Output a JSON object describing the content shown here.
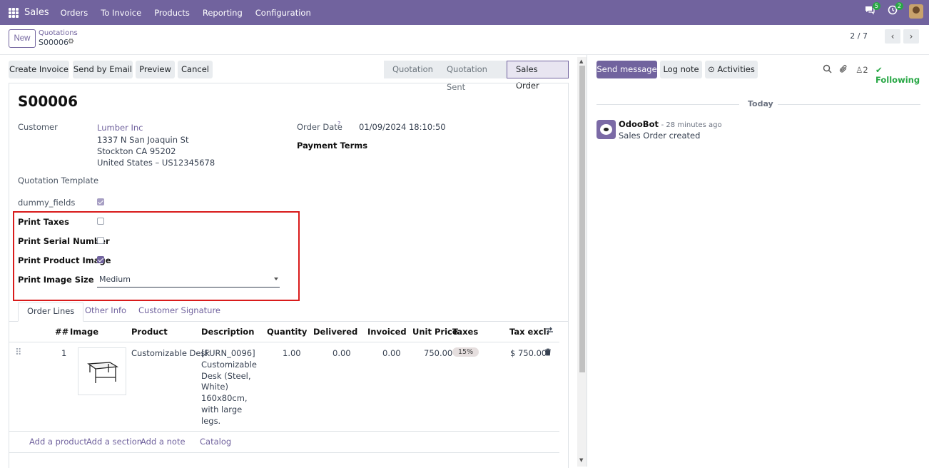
{
  "topbar": {
    "app_name": "Sales",
    "menu": [
      "Orders",
      "To Invoice",
      "Products",
      "Reporting",
      "Configuration"
    ],
    "messages_badge": "5",
    "activities_badge": "2"
  },
  "control": {
    "new_label": "New",
    "breadcrumb_parent": "Quotations",
    "breadcrumb_current": "S00006",
    "pager": "2 / 7"
  },
  "actions": {
    "create_invoice": "Create Invoice",
    "send_email": "Send by Email",
    "preview": "Preview",
    "cancel": "Cancel"
  },
  "statusbar": {
    "stages": [
      "Quotation",
      "Quotation Sent",
      "Sales Order"
    ],
    "active": "Sales Order"
  },
  "form": {
    "title": "S00006",
    "customer_label": "Customer",
    "customer_name": "Lumber Inc",
    "address_line1": "1337 N San Joaquin St",
    "address_line2": "Stockton CA 95202",
    "address_line3": "United States – US12345678",
    "order_date_label": "Order Date",
    "order_date_help": "?",
    "order_date": "01/09/2024 18:10:50",
    "payment_terms_label": "Payment Terms",
    "quotation_template_label": "Quotation Template",
    "dummy_fields_label": "dummy_fields",
    "print_taxes_label": "Print Taxes",
    "print_serial_label": "Print Serial Number",
    "print_product_image_label": "Print Product Image",
    "print_image_size_label": "Print Image Size",
    "print_image_size_value": "Medium",
    "dummy_fields_checked": true,
    "print_taxes_checked": false,
    "print_serial_checked": false,
    "print_product_image_checked": true
  },
  "tabs": [
    "Order Lines",
    "Other Info",
    "Customer Signature"
  ],
  "table": {
    "headers": [
      "##",
      "Image",
      "Product",
      "Description",
      "Quantity",
      "Delivered",
      "Invoiced",
      "Unit Price",
      "Taxes",
      "Tax excl."
    ],
    "row": {
      "seq": "1",
      "product": "Customizable Desk",
      "description": [
        "[FURN_0096]",
        "Customizable",
        "Desk (Steel,",
        "White)",
        "160x80cm,",
        "with large",
        "legs."
      ],
      "quantity": "1.00",
      "delivered": "0.00",
      "invoiced": "0.00",
      "unit_price": "750.00",
      "taxes": "15%",
      "subtotal": "$ 750.00"
    },
    "add_links": [
      "Add a product",
      "Add a section",
      "Add a note",
      "Catalog"
    ]
  },
  "chatter": {
    "send_message": "Send message",
    "log_note": "Log note",
    "activities": "Activities",
    "followers_count": "2",
    "following": "Following",
    "day_separator": "Today",
    "message_author": "OdooBot",
    "message_time": "- 28 minutes ago",
    "message_body": "Sales Order created"
  }
}
